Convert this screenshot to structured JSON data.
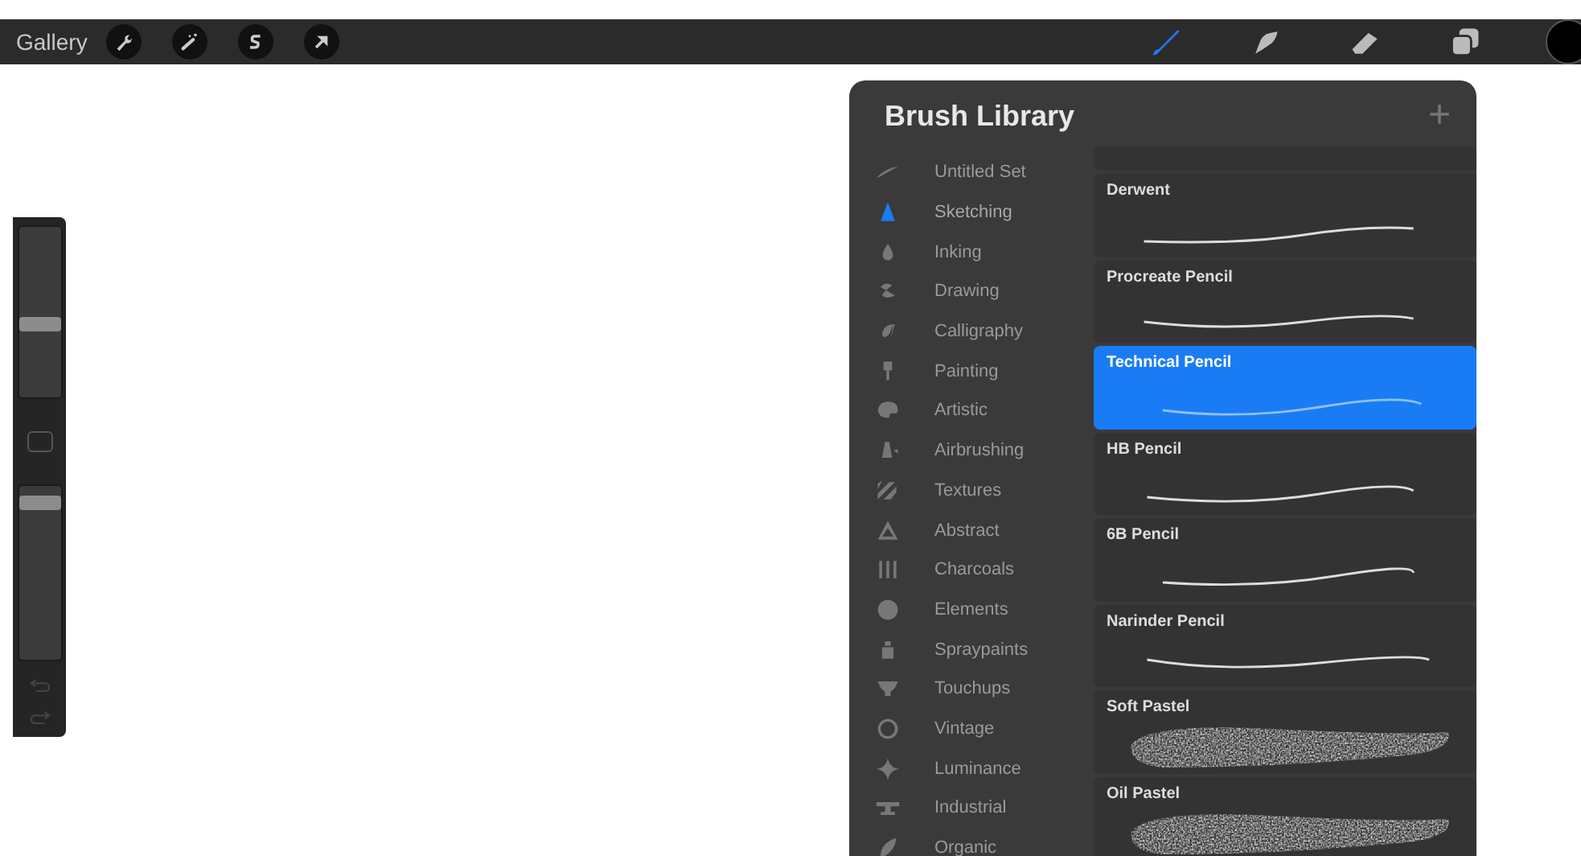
{
  "toolbar": {
    "gallery": "Gallery",
    "tools": [
      {
        "kind": "brush",
        "selected": true
      },
      {
        "kind": "smudge",
        "selected": false
      },
      {
        "kind": "eraser",
        "selected": false
      }
    ]
  },
  "side_panel": {
    "sliders": [
      {
        "level": 0.42
      },
      {
        "level": 0.94
      }
    ]
  },
  "brush_library": {
    "title": "Brush Library",
    "add_button": "+",
    "sets": [
      {
        "label": "Untitled Set",
        "selected": false
      },
      {
        "label": "Sketching",
        "selected": true
      },
      {
        "label": "Inking",
        "selected": false
      },
      {
        "label": "Drawing",
        "selected": false
      },
      {
        "label": "Calligraphy",
        "selected": false
      },
      {
        "label": "Painting",
        "selected": false
      },
      {
        "label": "Artistic",
        "selected": false
      },
      {
        "label": "Airbrushing",
        "selected": false
      },
      {
        "label": "Textures",
        "selected": false
      },
      {
        "label": "Abstract",
        "selected": false
      },
      {
        "label": "Charcoals",
        "selected": false
      },
      {
        "label": "Elements",
        "selected": false
      },
      {
        "label": "Spraypaints",
        "selected": false
      },
      {
        "label": "Touchups",
        "selected": false
      },
      {
        "label": "Vintage",
        "selected": false
      },
      {
        "label": "Luminance",
        "selected": false
      },
      {
        "label": "Industrial",
        "selected": false
      },
      {
        "label": "Organic",
        "selected": false
      }
    ],
    "brushes": [
      {
        "name": "Derwent",
        "kind": "line",
        "selected": false
      },
      {
        "name": "Procreate Pencil",
        "kind": "line",
        "selected": false
      },
      {
        "name": "Technical Pencil",
        "kind": "line",
        "selected": true
      },
      {
        "name": "HB Pencil",
        "kind": "line",
        "selected": false
      },
      {
        "name": "6B Pencil",
        "kind": "line",
        "selected": false
      },
      {
        "name": "Narinder Pencil",
        "kind": "line",
        "selected": false
      },
      {
        "name": "Soft Pastel",
        "kind": "texture",
        "selected": false
      },
      {
        "name": "Oil Pastel",
        "kind": "texture",
        "selected": false
      }
    ]
  }
}
